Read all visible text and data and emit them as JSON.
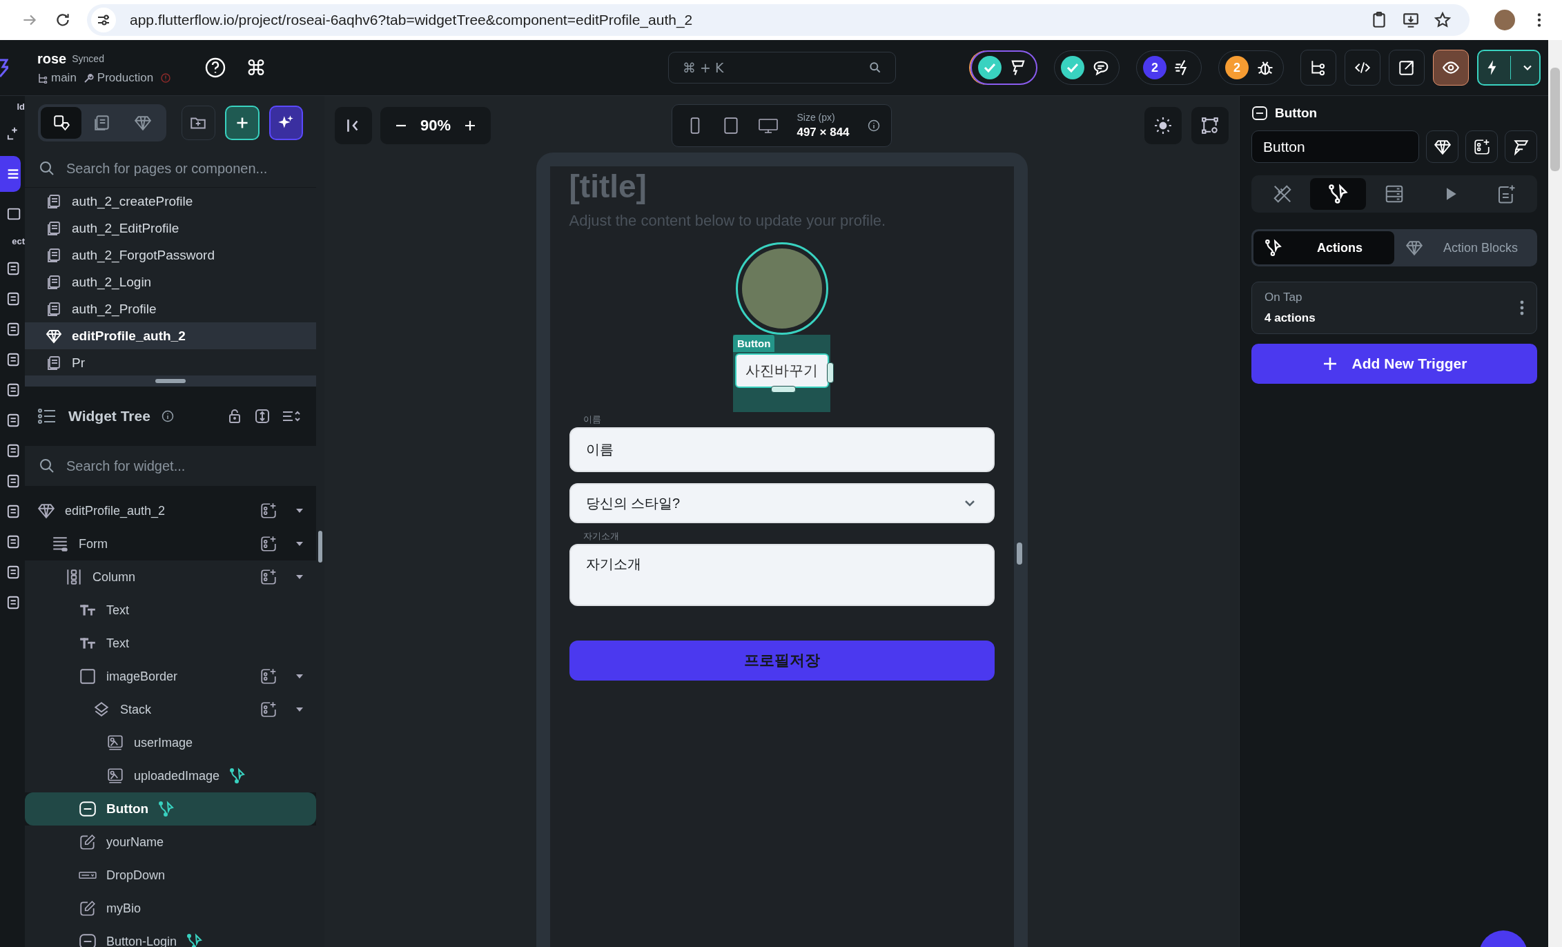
{
  "browser": {
    "url": "app.flutterflow.io/project/roseai-6aqhv6?tab=widgetTree&component=editProfile_auth_2"
  },
  "topbar": {
    "project": "rose",
    "sync_status": "Synced",
    "branch": "main",
    "environment": "Production",
    "command_key": "⌘",
    "search": {
      "placeholder": "⌘ + K"
    },
    "status_pills": [
      {
        "kind": "check",
        "active": true
      },
      {
        "kind": "check",
        "active": false
      },
      {
        "kind": "count",
        "count": "2",
        "color": "#4b39ef",
        "active": false
      },
      {
        "kind": "count",
        "count": "2",
        "color": "#f69c32",
        "active": false
      }
    ]
  },
  "rail": {
    "labels": [
      "ld",
      "ect"
    ]
  },
  "left_panel": {
    "view_tabs": [
      {
        "selected": true
      },
      {
        "selected": false
      },
      {
        "selected": false
      }
    ],
    "page_search": {
      "placeholder": "Search for pages or componen..."
    },
    "pages": [
      {
        "name": "auth_2_createProfile",
        "kind": "page",
        "selected": false
      },
      {
        "name": "auth_2_EditProfile",
        "kind": "page",
        "selected": false
      },
      {
        "name": "auth_2_ForgotPassword",
        "kind": "page",
        "selected": false
      },
      {
        "name": "auth_2_Login",
        "kind": "page",
        "selected": false
      },
      {
        "name": "auth_2_Profile",
        "kind": "page",
        "selected": false
      },
      {
        "name": "editProfile_auth_2",
        "kind": "component",
        "selected": true
      },
      {
        "name": "Pr",
        "kind": "page",
        "selected": false
      }
    ],
    "widget_tree": {
      "title": "Widget Tree",
      "search": {
        "placeholder": "Search for widget..."
      },
      "nodes": [
        {
          "name": "editProfile_auth_2",
          "kind": "component",
          "menu": true,
          "action": false,
          "selected": false,
          "children": [
            {
              "name": "Form",
              "kind": "form",
              "menu": true,
              "action": false,
              "selected": false,
              "children": [
                {
                  "name": "Column",
                  "kind": "column",
                  "menu": true,
                  "action": false,
                  "selected": false,
                  "children": [
                    {
                      "name": "Text",
                      "kind": "text",
                      "menu": false,
                      "action": false,
                      "selected": false
                    },
                    {
                      "name": "Text",
                      "kind": "text",
                      "menu": false,
                      "action": false,
                      "selected": false
                    },
                    {
                      "name": "imageBorder",
                      "kind": "container",
                      "menu": true,
                      "action": false,
                      "selected": false,
                      "children": [
                        {
                          "name": "Stack",
                          "kind": "stack",
                          "menu": true,
                          "action": false,
                          "selected": false,
                          "children": [
                            {
                              "name": "userImage",
                              "kind": "image",
                              "menu": false,
                              "action": false,
                              "selected": false
                            },
                            {
                              "name": "uploadedImage",
                              "kind": "image",
                              "menu": false,
                              "action": true,
                              "selected": false
                            }
                          ]
                        }
                      ]
                    },
                    {
                      "name": "Button",
                      "kind": "button",
                      "menu": false,
                      "action": true,
                      "selected": true
                    },
                    {
                      "name": "yourName",
                      "kind": "textfield",
                      "menu": false,
                      "action": false,
                      "selected": false
                    },
                    {
                      "name": "DropDown",
                      "kind": "dropdown",
                      "menu": false,
                      "action": false,
                      "selected": false
                    },
                    {
                      "name": "myBio",
                      "kind": "textfield",
                      "menu": false,
                      "action": false,
                      "selected": false
                    },
                    {
                      "name": "Button-Login",
                      "kind": "button",
                      "menu": false,
                      "action": true,
                      "selected": false
                    }
                  ]
                }
              ]
            }
          ]
        }
      ]
    }
  },
  "canvas": {
    "zoom": "90%",
    "size_label": "Size (px)",
    "size": "497 × 844",
    "screen": {
      "title": "[title]",
      "subtitle": "Adjust the content below to update your profile.",
      "selection_tag": "Button",
      "photo_button": "사진바꾸기",
      "name_field": {
        "label": "이름",
        "value": "이름"
      },
      "style_dropdown": {
        "value": "당신의 스타일?"
      },
      "bio_field": {
        "label": "자기소개",
        "value": "자기소개"
      },
      "save_button": "프로필저장"
    }
  },
  "right_panel": {
    "widget_type": "Button",
    "name_field": {
      "value": "Button"
    },
    "tabs": [
      {
        "selected": false
      },
      {
        "selected": true
      },
      {
        "selected": false
      },
      {
        "selected": false
      },
      {
        "selected": false
      }
    ],
    "sub_tabs": [
      {
        "label": "Actions",
        "selected": true
      },
      {
        "label": "Action Blocks",
        "selected": false
      }
    ],
    "triggers": [
      {
        "event": "On Tap",
        "summary": "4 actions"
      }
    ],
    "add_button": "Add New Trigger"
  }
}
